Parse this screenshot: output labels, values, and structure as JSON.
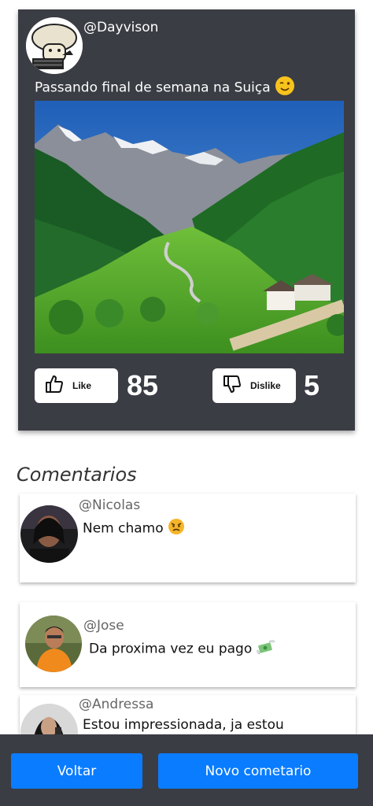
{
  "post": {
    "username": "@Dayvison",
    "caption": "Passando final de semana na Suiça",
    "caption_emoji": "winking-face",
    "like_label": "Like",
    "like_count": "85",
    "dislike_label": "Dislike",
    "dislike_count": "5"
  },
  "comments": {
    "title": "Comentarios",
    "items": [
      {
        "user": "@Nicolas",
        "text": "Nem chamo",
        "emoji": "angry-face"
      },
      {
        "user": "@Jose",
        "text": "Da proxima vez eu pago",
        "emoji": "money-with-wings"
      },
      {
        "user": "@Andressa",
        "text": "Estou impressionada, ja estou"
      }
    ]
  },
  "footer": {
    "back_label": "Voltar",
    "new_comment_label": "Novo cometario"
  },
  "colors": {
    "card_background": "#3a3d44",
    "primary_button": "#0a7cff"
  }
}
